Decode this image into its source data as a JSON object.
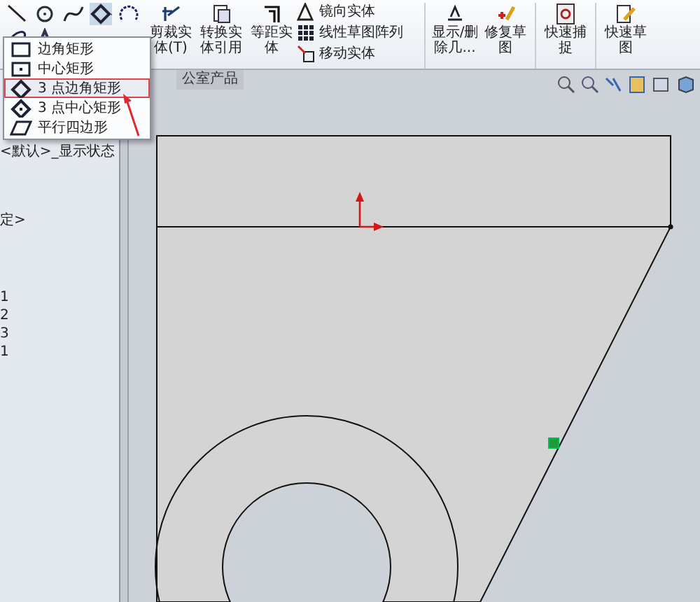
{
  "toolbar": {
    "big_buttons": [
      {
        "label": "剪裁实体(T)"
      },
      {
        "label": "转换实体引用"
      },
      {
        "label": "等距实体"
      }
    ],
    "list_buttons": [
      "镜向实体",
      "线性草图阵列",
      "移动实体"
    ],
    "more_buttons": [
      {
        "label": "显示/删除几..."
      },
      {
        "label": "修复草图"
      },
      {
        "label": "快速捕捉"
      },
      {
        "label": "快速草图"
      }
    ]
  },
  "rectangle_menu": [
    {
      "label": "边角矩形",
      "selected": false
    },
    {
      "label": "中心矩形",
      "selected": false
    },
    {
      "label": "3 点边角矩形",
      "selected": true
    },
    {
      "label": "3 点中心矩形",
      "selected": false
    },
    {
      "label": "平行四边形",
      "selected": false
    }
  ],
  "document_tab": "公室产品",
  "feature_tree": {
    "header": "<默认>_显示状态",
    "items": [
      "定>",
      "1",
      "2",
      "3",
      "1"
    ]
  }
}
